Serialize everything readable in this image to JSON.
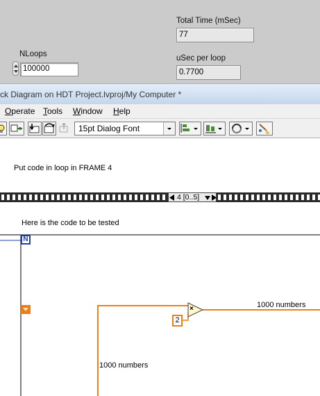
{
  "front_panel": {
    "total_time": {
      "label": "Total Time (mSec)",
      "value": "77"
    },
    "usec_per_loop": {
      "label": "uSec per loop",
      "value": "0.7700"
    },
    "nloops": {
      "label": "NLoops",
      "value": "100000"
    }
  },
  "window": {
    "title": "ck Diagram on HDT Project.lvproj/My Computer *"
  },
  "menu": {
    "operate": {
      "mnemonic": "O",
      "rest": "perate"
    },
    "tools": {
      "mnemonic": "T",
      "rest": "ools"
    },
    "window": {
      "mnemonic": "W",
      "rest": "indow"
    },
    "help": {
      "mnemonic": "H",
      "rest": "elp"
    }
  },
  "toolbar": {
    "font_select_value": "15pt Dialog Font"
  },
  "diagram": {
    "comment_top": "Put code in loop in FRAME 4",
    "frame_selector": "4 [0..5]",
    "comment_frame": "Here is the code to be tested",
    "count_terminal": "N",
    "constant_2": "2",
    "wire_label_right": "1000 numbers",
    "wire_label_down": "1000 numbers",
    "multiply_symbol": "×"
  },
  "colors": {
    "orange_wire": "#ee7d13",
    "loop_blue": "#1f3fa8",
    "frame_border": "#000000"
  }
}
